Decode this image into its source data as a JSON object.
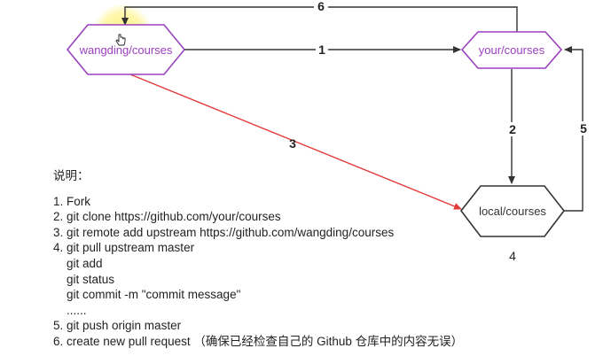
{
  "nodes": {
    "upstream": {
      "label": "wangding/courses",
      "color": "#9b3fc0"
    },
    "fork": {
      "label": "your/courses",
      "color": "#9b3fc0"
    },
    "local": {
      "label": "local/courses",
      "color": "#333333"
    }
  },
  "arrows": {
    "a1": "1",
    "a2": "2",
    "a3": "3",
    "a4": "4",
    "a5": "5",
    "a6": "6"
  },
  "colors": {
    "red_arrow": "#e23b3b",
    "black_arrow": "#333333",
    "cursor_highlight": "#fff27a"
  },
  "notes": {
    "title": "说明：",
    "lines": [
      "1. Fork",
      "2. git clone https://github.com/your/courses",
      "3. git remote add upstream https://github.com/wangding/courses",
      "4. git pull upstream master",
      "    git add",
      "    git status",
      "    git commit -m \"commit message\"",
      "    ......",
      "5. git push origin master",
      "6. create new pull request （确保已经检查自己的 Github 仓库中的内容无误）"
    ]
  }
}
